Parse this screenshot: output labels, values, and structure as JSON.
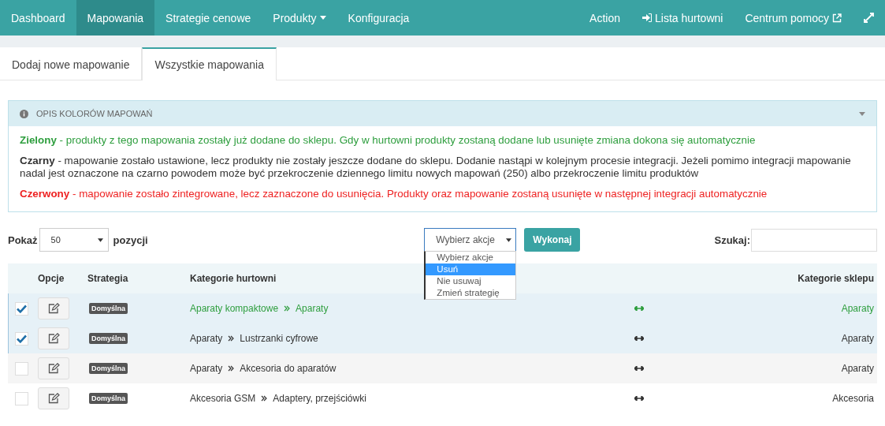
{
  "nav": {
    "items": [
      {
        "label": "Dashboard",
        "selected": false,
        "dropdown": false
      },
      {
        "label": "Mapowania",
        "selected": true,
        "dropdown": false
      },
      {
        "label": "Strategie cenowe",
        "selected": false,
        "dropdown": false
      },
      {
        "label": "Produkty",
        "selected": false,
        "dropdown": true
      },
      {
        "label": "Konfiguracja",
        "selected": false,
        "dropdown": false
      }
    ],
    "right_items": [
      {
        "label": "Action",
        "kind": "plain"
      },
      {
        "label": "Lista hurtowni",
        "kind": "leading"
      },
      {
        "label": "Centrum pomocy",
        "kind": "trailing"
      }
    ]
  },
  "tabs": [
    {
      "label": "Dodaj nowe mapowanie",
      "selected": false
    },
    {
      "label": "Wszystkie mapowania",
      "selected": true
    }
  ],
  "legend": {
    "title": "OPIS KOLORÓW MAPOWAŃ",
    "expanded": true,
    "items": [
      {
        "text": "**Zielony** - produkty z tego mapowania zostały już dodane do sklepu. Gdy w hurtowni produkty zostaną dodane lub usunięte zmiana dokona się automatycznie",
        "color": "#2e9e3e"
      },
      {
        "text": "**Czarny** - mapowanie zostało ustawione, lecz produkty nie zostały jeszcze dodane do sklepu. Dodanie nastąpi w kolejnym procesie integracji. Jeżeli pomimo integracji mapowanie nadal jest oznaczone na czarno powodem może być przekroczenie dziennego limitu nowych mapowań (250) albo przekroczenie limitu produktów",
        "color": "#333333"
      },
      {
        "text": "**Czerwony** - mapowanie zostało zintegrowane, lecz zaznaczone do usunięcia. Produkty oraz mapowanie zostaną usunięte w następnej integracji automatycznie",
        "color": "#ee2222"
      }
    ]
  },
  "controls": {
    "show_label": "Pokaż",
    "page_size": "50",
    "show_suffix": "pozycji",
    "action_select": {
      "value": "Wybierz akcje",
      "expanded": true,
      "options": [
        {
          "label": "Wybierz akcje",
          "highlighted": false
        },
        {
          "label": "Usuń",
          "highlighted": true
        },
        {
          "label": "Nie usuwaj",
          "highlighted": false
        },
        {
          "label": "Zmień strategię",
          "highlighted": false
        }
      ]
    },
    "execute_button": "Wykonaj",
    "search_label": "Szukaj:"
  },
  "table": {
    "columns": [
      "Opcje",
      "Strategia",
      "Kategorie hurtowni",
      "Kategorie sklepu"
    ],
    "rows": [
      {
        "checked": true,
        "strategy": "Domyślna",
        "source": [
          "Aparaty kompaktowe",
          "Aparaty"
        ],
        "target": "Aparaty",
        "color": "#2e9e3e"
      },
      {
        "checked": true,
        "strategy": "Domyślna",
        "source": [
          "Aparaty",
          "Lustrzanki cyfrowe"
        ],
        "target": "Aparaty",
        "color": "#333333"
      },
      {
        "checked": false,
        "strategy": "Domyślna",
        "source": [
          "Aparaty",
          "Akcesoria do aparatów"
        ],
        "target": "Aparaty",
        "color": "#333333"
      },
      {
        "checked": false,
        "strategy": "Domyślna",
        "source": [
          "Akcesoria GSM",
          "Adaptery, przejściówki"
        ],
        "target": "Akcesoria",
        "color": "#333333"
      }
    ]
  }
}
